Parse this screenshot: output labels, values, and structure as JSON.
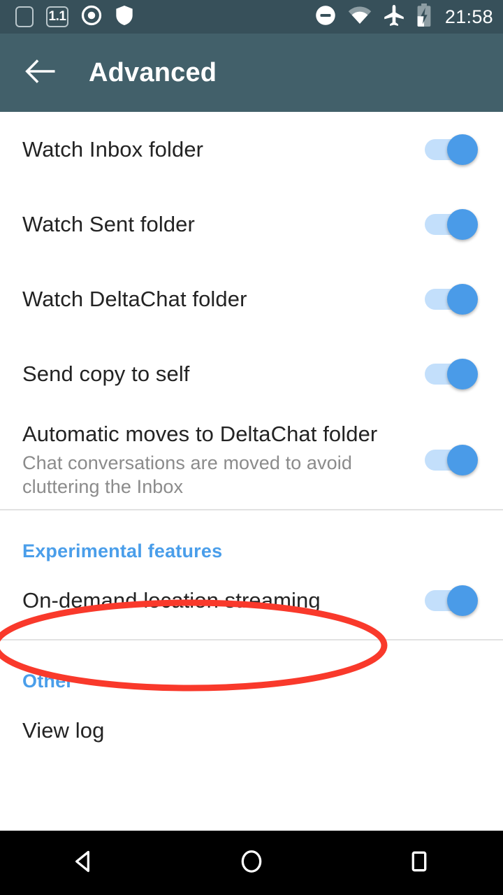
{
  "status_bar": {
    "icons_left": [
      {
        "name": "empty-box-icon",
        "label": ""
      },
      {
        "name": "version-badge-icon",
        "label": "1.1"
      },
      {
        "name": "record-dot-icon",
        "label": ""
      },
      {
        "name": "shield-icon",
        "label": ""
      }
    ],
    "icons_right": [
      {
        "name": "do-not-disturb-icon",
        "label": ""
      },
      {
        "name": "wifi-icon",
        "label": ""
      },
      {
        "name": "airplane-mode-icon",
        "label": ""
      },
      {
        "name": "battery-charging-icon",
        "label": ""
      }
    ],
    "time": "21:58",
    "background": "#37505A"
  },
  "app_bar": {
    "title": "Advanced",
    "back_icon": "arrow-back-icon",
    "background": "#42606A",
    "text_color": "#ffffff"
  },
  "colors": {
    "accent": "#4A9EEA",
    "switch_on_thumb": "#4A9BE8",
    "switch_on_track": "#c3dffb",
    "annotation_red": "#F9392B",
    "divider": "#e2e2e2",
    "title_text": "#232323",
    "summary_text": "#8b8b8b"
  },
  "settings": {
    "main_rows": [
      {
        "name": "watch-inbox-folder",
        "title": "Watch Inbox folder",
        "summary": "",
        "switch_state": "on"
      },
      {
        "name": "watch-sent-folder",
        "title": "Watch Sent folder",
        "summary": "",
        "switch_state": "on"
      },
      {
        "name": "watch-deltachat-folder",
        "title": "Watch DeltaChat folder",
        "summary": "",
        "switch_state": "on"
      },
      {
        "name": "send-copy-to-self",
        "title": "Send copy to self",
        "summary": "",
        "switch_state": "on"
      },
      {
        "name": "automatic-moves-to-deltachat-folder",
        "title": "Automatic moves to DeltaChat folder",
        "summary": "Chat conversations are moved to avoid cluttering the Inbox",
        "switch_state": "on"
      }
    ],
    "experimental_section": {
      "header": "Experimental features",
      "rows": [
        {
          "name": "on-demand-location-streaming",
          "title": "On-demand location streaming",
          "summary": "",
          "switch_state": "on",
          "annotated": true
        }
      ]
    },
    "other_section": {
      "header": "Other",
      "rows": [
        {
          "name": "view-log",
          "title": "View log",
          "summary": ""
        }
      ]
    }
  },
  "nav_bar": {
    "buttons": [
      {
        "name": "nav-back-button",
        "icon": "triangle-back-icon"
      },
      {
        "name": "nav-home-button",
        "icon": "circle-home-icon"
      },
      {
        "name": "nav-recents-button",
        "icon": "square-recents-icon"
      }
    ],
    "background": "#000000"
  }
}
